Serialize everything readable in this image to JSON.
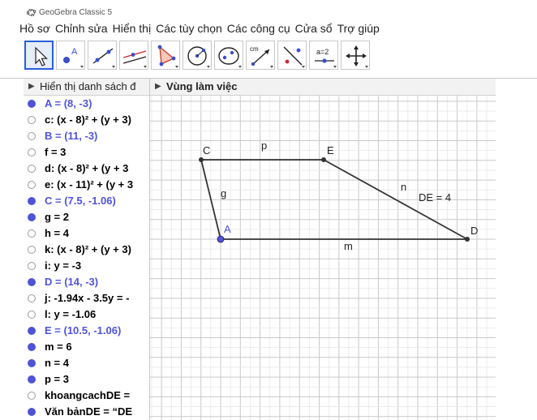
{
  "app": {
    "title": "GeoGebra Classic 5"
  },
  "menu": [
    "Hồ sơ",
    "Chỉnh sửa",
    "Hiển thị",
    "Các tùy chọn",
    "Các công cụ",
    "Cửa sổ",
    "Trợ giúp"
  ],
  "toolbar": {
    "tools": [
      {
        "name": "move-tool-button",
        "icon": "arrow-cursor-icon",
        "active": true
      },
      {
        "name": "point-tool-button",
        "icon": "point-icon",
        "label": "A"
      },
      {
        "name": "line-tool-button",
        "icon": "line-icon"
      },
      {
        "name": "perpendicular-tool-button",
        "icon": "parallel-lines-icon"
      },
      {
        "name": "polygon-tool-button",
        "icon": "triangle-icon"
      },
      {
        "name": "circle-tool-button",
        "icon": "circle-center-icon"
      },
      {
        "name": "ellipse-tool-button",
        "icon": "ellipse-icon"
      },
      {
        "name": "distance-tool-button",
        "icon": "ruler-icon",
        "label": "cm"
      },
      {
        "name": "reflect-tool-button",
        "icon": "reflect-icon"
      },
      {
        "name": "slider-tool-button",
        "icon": "slider-icon",
        "label": "a=2"
      },
      {
        "name": "move-view-tool-button",
        "icon": "move-cross-icon"
      }
    ]
  },
  "algebra": {
    "header": "Hiển thị danh sách đ",
    "items": [
      {
        "text": "A = (8, -3)",
        "shown": true,
        "color": "#4e54d6"
      },
      {
        "text": "c: (x - 8)² + (y + 3)",
        "shown": false,
        "color": "#000000"
      },
      {
        "text": "B = (11, -3)",
        "shown": false,
        "color": "#4e54d6"
      },
      {
        "text": "f = 3",
        "shown": false,
        "color": "#000000"
      },
      {
        "text": "d: (x - 8)² + (y + 3",
        "shown": false,
        "color": "#000000"
      },
      {
        "text": "e: (x - 11)² + (y + 3",
        "shown": false,
        "color": "#000000"
      },
      {
        "text": "C = (7.5, -1.06)",
        "shown": true,
        "color": "#4e54d6"
      },
      {
        "text": "g = 2",
        "shown": true,
        "color": "#000000"
      },
      {
        "text": "h = 4",
        "shown": false,
        "color": "#000000"
      },
      {
        "text": "k: (x - 8)² + (y + 3)",
        "shown": false,
        "color": "#000000"
      },
      {
        "text": "i: y = -3",
        "shown": false,
        "color": "#000000"
      },
      {
        "text": "D = (14, -3)",
        "shown": true,
        "color": "#4e54d6"
      },
      {
        "text": "j: -1.94x - 3.5y = -",
        "shown": false,
        "color": "#000000"
      },
      {
        "text": "l: y = -1.06",
        "shown": false,
        "color": "#000000"
      },
      {
        "text": "E = (10.5, -1.06)",
        "shown": true,
        "color": "#4e54d6"
      },
      {
        "text": "m = 6",
        "shown": true,
        "color": "#000000"
      },
      {
        "text": "n = 4",
        "shown": true,
        "color": "#000000"
      },
      {
        "text": "p = 3",
        "shown": true,
        "color": "#000000"
      },
      {
        "text": "khoangcachDE =",
        "shown": false,
        "color": "#000000"
      },
      {
        "text": "Văn bảnDE = “DE",
        "shown": true,
        "color": "#000000"
      }
    ]
  },
  "graphics": {
    "header": "Vùng làm việc",
    "point_color": "#4e54d6",
    "point_labels": {
      "A": "A",
      "C": "C",
      "D": "D",
      "E": "E"
    },
    "segment_labels": {
      "g": "g",
      "p": "p",
      "n": "n",
      "m": "m"
    },
    "text_DE": "DE = 4"
  }
}
